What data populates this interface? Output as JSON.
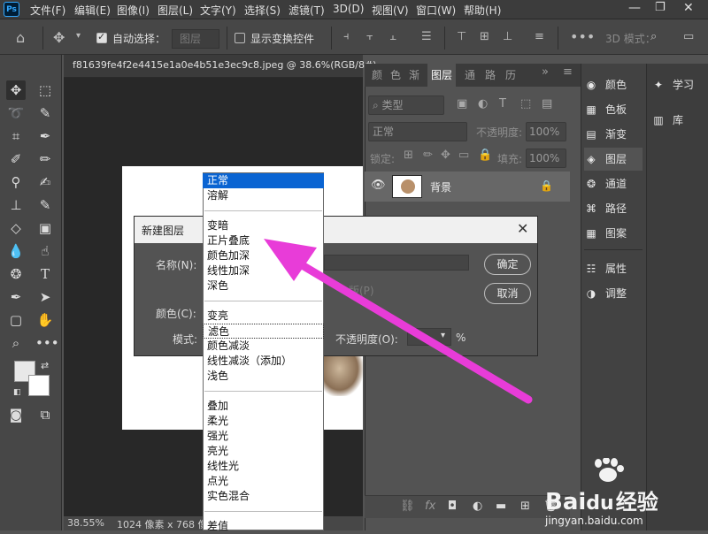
{
  "app": {
    "logo": "Ps"
  },
  "menubar": [
    "文件(F)",
    "编辑(E)",
    "图像(I)",
    "图层(L)",
    "文字(Y)",
    "选择(S)",
    "滤镜(T)",
    "3D(D)",
    "视图(V)",
    "窗口(W)",
    "帮助(H)"
  ],
  "options": {
    "auto_select_label": "自动选择：",
    "auto_select_value": "图层",
    "show_transform_label": "显示变换控件",
    "mode_3d": "3D 模式："
  },
  "document": {
    "tab_title": "f81639fe4f2e4415e1a0e4b51e3ec9c8.jpeg @ 38.6%(RGB/8#)",
    "zoom": "38.55%",
    "size_info": "1024 像素 x 768 像"
  },
  "layers_panel": {
    "tabs": [
      "颜",
      "色",
      "渐",
      "图层",
      "通",
      "路",
      "历"
    ],
    "active_tab": "图层",
    "filter_placeholder": "类型",
    "blend_mode": "正常",
    "opacity_label": "不透明度:",
    "opacity_value": "100%",
    "lock_label": "锁定:",
    "fill_label": "填充:",
    "fill_value": "100%",
    "layer_name": "背景",
    "footer_fx": "fx"
  },
  "dock1": [
    {
      "label": "颜色",
      "icon": "palette-icon"
    },
    {
      "label": "色板",
      "icon": "grid-icon"
    },
    {
      "label": "渐变",
      "icon": "gradient-icon"
    },
    {
      "label": "图层",
      "icon": "layers-icon",
      "active": true
    },
    {
      "label": "通道",
      "icon": "channels-icon"
    },
    {
      "label": "路径",
      "icon": "path-icon"
    },
    {
      "label": "图案",
      "icon": "pattern-icon"
    },
    {
      "label": "属性",
      "icon": "properties-icon"
    },
    {
      "label": "调整",
      "icon": "adjust-icon"
    }
  ],
  "dock2": [
    {
      "label": "学习",
      "icon": "bulb-icon"
    },
    {
      "label": "库",
      "icon": "library-icon"
    }
  ],
  "dialog": {
    "title": "新建图层",
    "name_label": "名称(N):",
    "color_label": "颜色(C):",
    "mode_label": "模式:",
    "partial_text": "版(P)",
    "opacity_label": "不透明度(O):",
    "opacity_value": "",
    "percent": "%",
    "ok": "确定",
    "cancel": "取消"
  },
  "blend_menu": {
    "groups": [
      [
        "正常",
        "溶解"
      ],
      [
        "变暗",
        "正片叠底",
        "颜色加深",
        "线性加深",
        "深色"
      ],
      [
        "变亮",
        "滤色",
        "颜色减淡",
        "线性减淡（添加）",
        "浅色"
      ],
      [
        "叠加",
        "柔光",
        "强光",
        "亮光",
        "线性光",
        "点光",
        "实色混合"
      ],
      [
        "差值"
      ]
    ],
    "selected": "正常",
    "hovered": "滤色"
  },
  "annotation": {
    "color": "#e83cd8"
  },
  "watermark": {
    "brand_a": "Bai",
    "brand_b": "du",
    "brand_c": "经验",
    "url": "jingyan.baidu.com"
  }
}
